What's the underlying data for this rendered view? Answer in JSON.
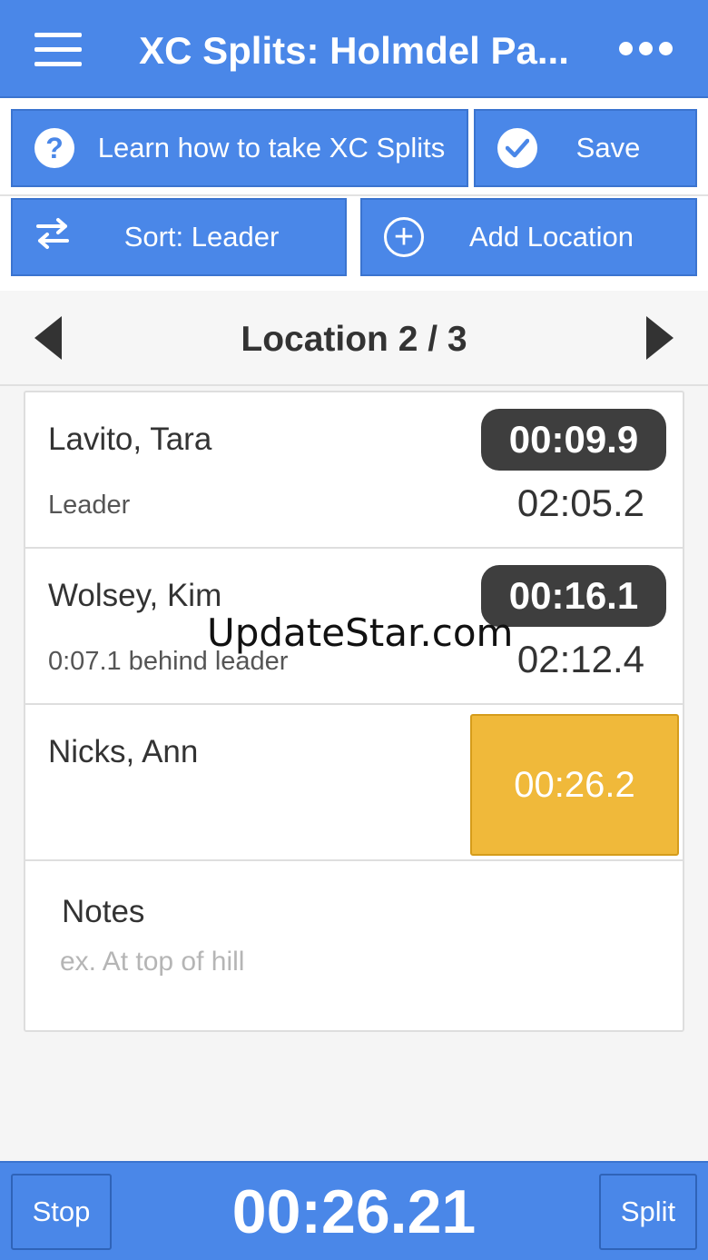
{
  "header": {
    "title": "XC Splits: Holmdel Pa...",
    "menu_icon": "hamburger-menu-icon",
    "more_icon": "more-horizontal-icon"
  },
  "toolbar": {
    "learn_label": "Learn how to take XC Splits",
    "save_label": "Save",
    "sort_label": "Sort: Leader",
    "add_location_label": "Add Location"
  },
  "location": {
    "title": "Location 2 / 3"
  },
  "runners": [
    {
      "name": "Lavito, Tara",
      "status": "Leader",
      "split": "00:09.9",
      "total": "02:05.2"
    },
    {
      "name": "Wolsey, Kim",
      "status": "0:07.1 behind leader",
      "split": "00:16.1",
      "total": "02:12.4"
    },
    {
      "name": "Nicks, Ann",
      "split_button": "00:26.2"
    }
  ],
  "notes": {
    "label": "Notes",
    "placeholder": "ex. At top of hill",
    "value": ""
  },
  "watermark": "UpdateStar.com",
  "footer": {
    "stop_label": "Stop",
    "timer": "00:26.21",
    "split_label": "Split"
  },
  "colors": {
    "primary": "#4a87e8",
    "pill": "#3e3e3e",
    "pending_split": "#f0b93a"
  }
}
